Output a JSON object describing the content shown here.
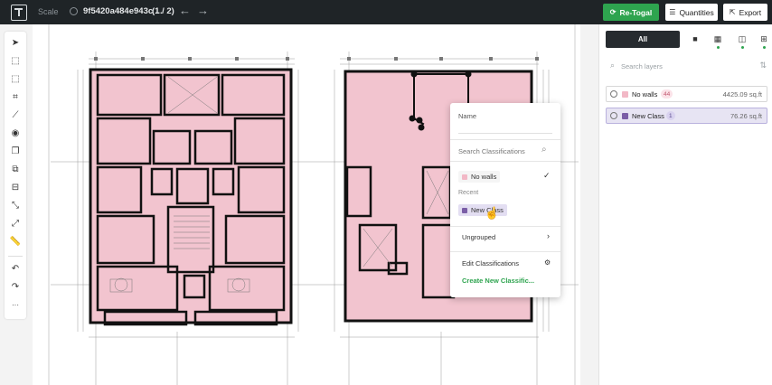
{
  "header": {
    "scale_label": "Scale",
    "file_title": "9f5420a484e943c ...",
    "pager": "(1 / 2)",
    "prev_arrow": "←",
    "next_arrow": "→",
    "retogal_label": "Re-Togal",
    "quantities_label": "Quantities",
    "export_label": "Export"
  },
  "toolbar": {
    "tools": [
      "cursor-icon",
      "select-box-icon",
      "polygon-icon",
      "crop-icon",
      "line-icon",
      "circle-point-icon",
      "duplicate-icon",
      "copy-area-icon",
      "merge-icon",
      "measure-icon",
      "ruler-diagonal-icon",
      "ruler-icon"
    ],
    "undo_icon": "undo-icon",
    "redo_icon": "redo-icon",
    "more_label": "···"
  },
  "panel": {
    "tab_all_label": "All",
    "search_placeholder": "Search layers",
    "layers": [
      {
        "name": "No walls",
        "count": "44",
        "area": "4425.09 sq.ft",
        "color": "#f2b8c6"
      },
      {
        "name": "New Class",
        "count": "1",
        "area": "76.26 sq.ft",
        "color": "#7b5ea7"
      }
    ]
  },
  "popup": {
    "name_label": "Name",
    "search_placeholder": "Search Classifications",
    "no_walls_label": "No walls",
    "recent_label": "Recent",
    "new_class_label": "New Class",
    "ungrouped_label": "Ungrouped",
    "edit_label": "Edit Classifications",
    "create_label": "Create New Classific..."
  },
  "colors": {
    "accent_green": "#2ea44f",
    "topbar": "#1f2427",
    "room_fill": "#f2c4cf"
  }
}
